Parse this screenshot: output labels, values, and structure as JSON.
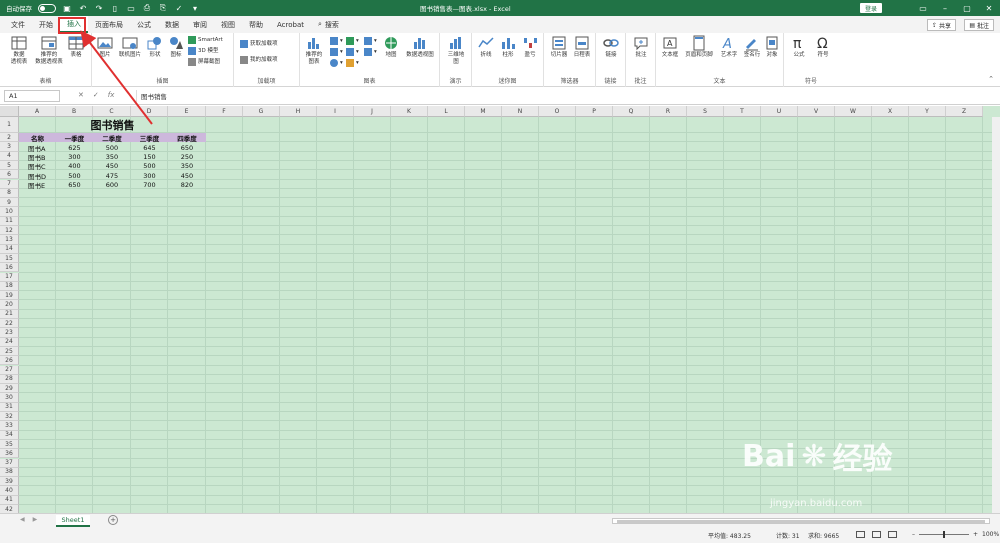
{
  "titlebar": {
    "autosave": "自动保存",
    "title": "图书销售表—图表.xlsx - Excel",
    "login": "登录"
  },
  "tabs": [
    "文件",
    "开始",
    "插入",
    "页面布局",
    "公式",
    "数据",
    "审阅",
    "视图",
    "帮助",
    "Acrobat"
  ],
  "search_label": "搜索",
  "share": "共享",
  "comment": "批注",
  "ribbon": {
    "pivot": "数据\n透视表",
    "rec_pivot": "推荐的\n数据透视表",
    "table": "表格",
    "group_tables": "表格",
    "picture": "图片",
    "online_picture": "联机图片",
    "shapes": "形状",
    "icons": "图标",
    "smartart": "SmartArt",
    "model3d": "3D 模型",
    "screenshot": "屏幕截图",
    "group_illust": "插图",
    "get_addins": "获取加载项",
    "my_addins": "我的加载项",
    "group_addins": "加载项",
    "rec_charts": "推荐的\n图表",
    "maps": "地图",
    "pivot_chart": "数据透视图",
    "group_charts": "图表",
    "map3d": "三维地\n图",
    "group_tours": "演示",
    "line": "折线",
    "column": "柱形",
    "winloss": "盈亏",
    "group_spark": "迷你图",
    "slicer": "切片器",
    "timeline": "日程表",
    "group_filter": "筛选器",
    "link": "链接",
    "group_link": "链接",
    "comment_btn": "批注",
    "group_comment": "批注",
    "textbox": "文本框",
    "header_footer": "页眉和页脚",
    "wordart": "艺术字",
    "signature": "签名行",
    "object": "对象",
    "group_text": "文本",
    "equation": "公式",
    "symbol": "符号",
    "group_symbols": "符号"
  },
  "formula_bar": {
    "name_box": "A1",
    "content": "图书销售"
  },
  "columns": [
    "A",
    "B",
    "C",
    "D",
    "E",
    "F",
    "G",
    "H",
    "I",
    "J",
    "K",
    "L",
    "M",
    "N",
    "O",
    "P",
    "Q",
    "R",
    "S",
    "T",
    "U",
    "V",
    "W",
    "X",
    "Y",
    "Z"
  ],
  "sheet": {
    "title": "图书销售",
    "headers": [
      "名称",
      "一季度",
      "二季度",
      "三季度",
      "四季度"
    ],
    "rows": [
      [
        "图书A",
        "625",
        "500",
        "645",
        "650"
      ],
      [
        "图书B",
        "300",
        "350",
        "150",
        "250"
      ],
      [
        "图书C",
        "400",
        "450",
        "500",
        "350"
      ],
      [
        "图书D",
        "500",
        "475",
        "300",
        "450"
      ],
      [
        "图书E",
        "650",
        "600",
        "700",
        "820"
      ]
    ]
  },
  "sheet_tab": "Sheet1",
  "status": {
    "average": "平均值: 483.25",
    "count": "计数: 31",
    "sum": "求和: 9665",
    "zoom": "100%"
  },
  "watermark": {
    "brand": "Bai",
    "brand2": "经验",
    "url": "jingyan.baidu.com"
  },
  "colors": {
    "accent": "#217346",
    "sheet_bg": "#cce8d2",
    "header_row": "#cdb8dc",
    "highlight": "#e03030"
  }
}
